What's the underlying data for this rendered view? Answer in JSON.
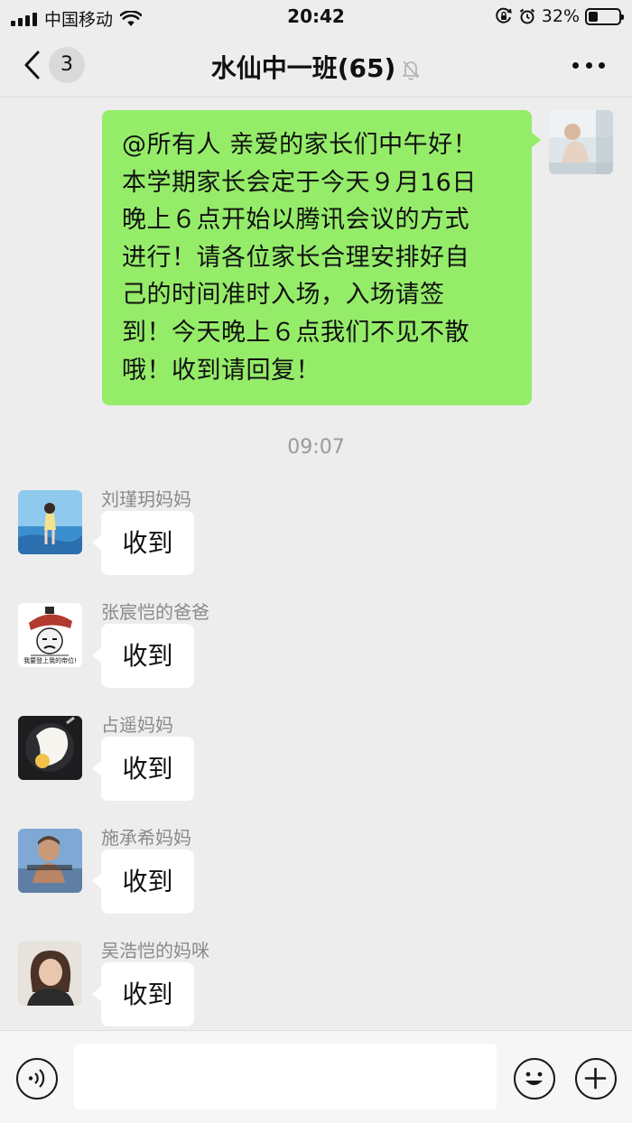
{
  "status_bar": {
    "carrier": "中国移动",
    "time": "20:42",
    "battery_percent": "32%",
    "battery_level": 0.32,
    "icons": [
      "signal-icon",
      "wifi-icon",
      "orientation-lock-icon",
      "alarm-icon",
      "battery-icon"
    ]
  },
  "nav": {
    "unread_count": "3",
    "title": "水仙中一班(65)",
    "icons": [
      "back-icon",
      "mute-bell-icon",
      "more-icon"
    ]
  },
  "messages": {
    "self": {
      "text": "@所有人 亲爱的家长们中午好！本学期家长会定于今天９月16日晚上６点开始以腾讯会议的方式进行！请各位家长合理安排好自己的时间准时入场，入场请签到！今天晚上６点我们不见不散哦！收到请回复！",
      "lines": [
        "@所有人 亲爱的家长们中午好！",
        "本学期家长会定于今天９月16日",
        "晚上６点开始以腾讯会议的方式",
        "进行！请各位家长合理安排好自",
        "己的时间准时入场，入场请签",
        "到！今天晚上６点我们不见不散",
        "哦！收到请回复！"
      ]
    },
    "timestamp": "09:07",
    "replies": [
      {
        "sender": "刘瑾玥妈妈",
        "text": "收到"
      },
      {
        "sender": "张宸恺的爸爸",
        "text": "收到",
        "avatar_caption": "我要登上我的帝位!"
      },
      {
        "sender": "占遥妈妈",
        "text": "收到"
      },
      {
        "sender": "施承希妈妈",
        "text": "收到"
      },
      {
        "sender": "吴浩恺的妈咪",
        "text": "收到"
      }
    ]
  },
  "input_bar": {
    "placeholder": "",
    "icons": [
      "voice-icon",
      "emoji-icon",
      "plus-icon"
    ]
  },
  "colors": {
    "self_bubble": "#95ec69",
    "background": "#ededed",
    "other_bubble": "#ffffff"
  }
}
